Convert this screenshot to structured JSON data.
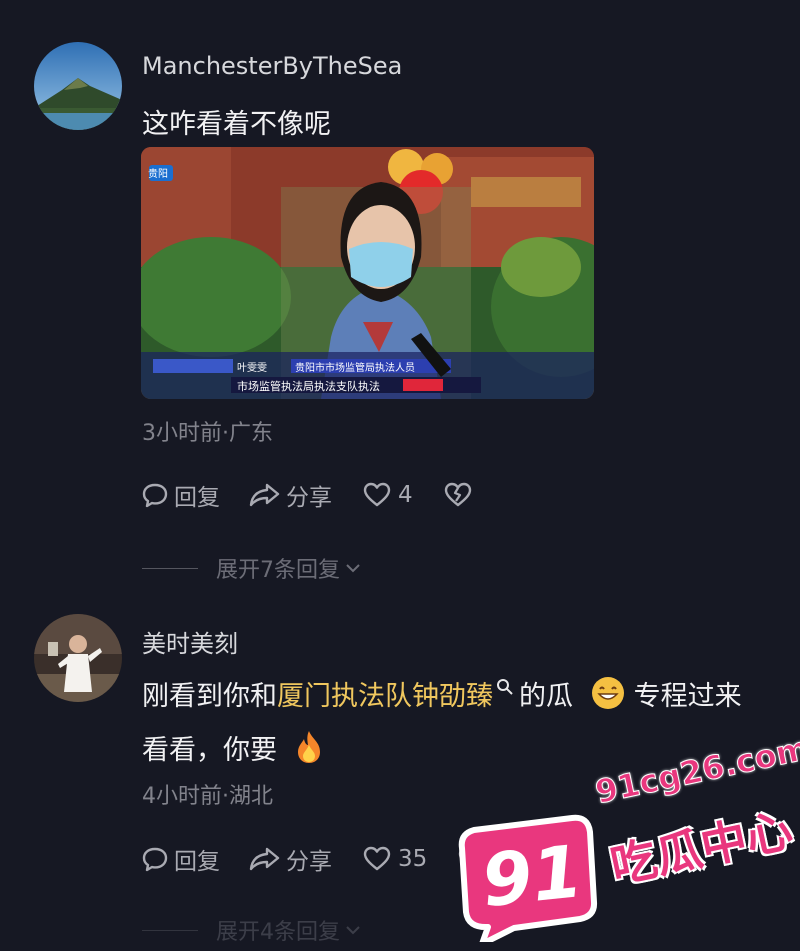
{
  "comments": [
    {
      "username": "ManchesterByTheSea",
      "text": "这咋看着不像呢",
      "meta": "3小时前·广东",
      "reply_label": "回复",
      "share_label": "分享",
      "like_count": "4",
      "expand_label": "展开7条回复"
    },
    {
      "username": "美时美刻",
      "text_before": "刚看到你和",
      "link_text": "厦门执法队钟劭臻",
      "text_middle": "的瓜",
      "text_after": "专程过来看看，你要",
      "meta": "4小时前·湖北",
      "reply_label": "回复",
      "share_label": "分享",
      "like_count": "35",
      "expand_label": "展开4条回复"
    }
  ],
  "video_thumbnail": {
    "caption_name": "叶雯雯",
    "caption_title": "贵阳市市场监管局执法人员",
    "caption_line": "市场监管执法局执法支队执法",
    "logo_text": "贵阳"
  },
  "watermark": {
    "number": "91",
    "domain": "91cg26.com",
    "label": "吃瓜中心"
  },
  "colors": {
    "background": "#161823",
    "link": "#f0c75e",
    "watermark_pink": "#e9377e"
  }
}
